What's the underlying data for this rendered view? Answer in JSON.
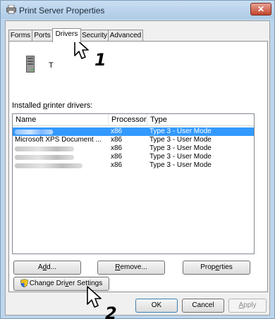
{
  "window": {
    "title": "Print Server Properties",
    "close_label": "✕",
    "accent_color": "#3399ff"
  },
  "tabs": [
    {
      "label": "Forms",
      "active": false
    },
    {
      "label": "Ports",
      "active": false
    },
    {
      "label": "Drivers",
      "active": true
    },
    {
      "label": "Security",
      "active": false
    },
    {
      "label": "Advanced",
      "active": false
    }
  ],
  "server": {
    "name": "T",
    "icon": "server-icon"
  },
  "drivers_section": {
    "label_prefix": "Installed ",
    "label_accel": "p",
    "label_suffix": "rinter drivers:"
  },
  "list": {
    "columns": [
      "Name",
      "Processor",
      "Type"
    ],
    "rows": [
      {
        "name": "",
        "name_redacted": true,
        "processor": "x86",
        "type": "Type 3 - User Mode",
        "selected": true
      },
      {
        "name": "Microsoft XPS Document ...",
        "name_redacted": false,
        "processor": "x86",
        "type": "Type 3 - User Mode",
        "selected": false
      },
      {
        "name": "",
        "name_redacted": true,
        "processor": "x86",
        "type": "Type 3 - User Mode",
        "selected": false
      },
      {
        "name": "",
        "name_redacted": true,
        "processor": "x86",
        "type": "Type 3 - User Mode",
        "selected": false
      },
      {
        "name": "",
        "name_redacted": true,
        "processor": "x86",
        "type": "Type 3 - User Mode",
        "selected": false
      }
    ]
  },
  "buttons": {
    "add": {
      "pre": "A",
      "accel": "d",
      "post": "d..."
    },
    "remove": {
      "pre": "",
      "accel": "R",
      "post": "emove..."
    },
    "properties": {
      "pre": "Prop",
      "accel": "e",
      "post": "rties"
    },
    "change_settings": {
      "pre": "Change Dri",
      "accel": "v",
      "post": "er Settings"
    },
    "ok": "OK",
    "cancel": "Cancel",
    "apply": {
      "pre": "",
      "accel": "A",
      "post": "pply"
    }
  },
  "callouts": {
    "step1": "1",
    "step2": "2"
  }
}
